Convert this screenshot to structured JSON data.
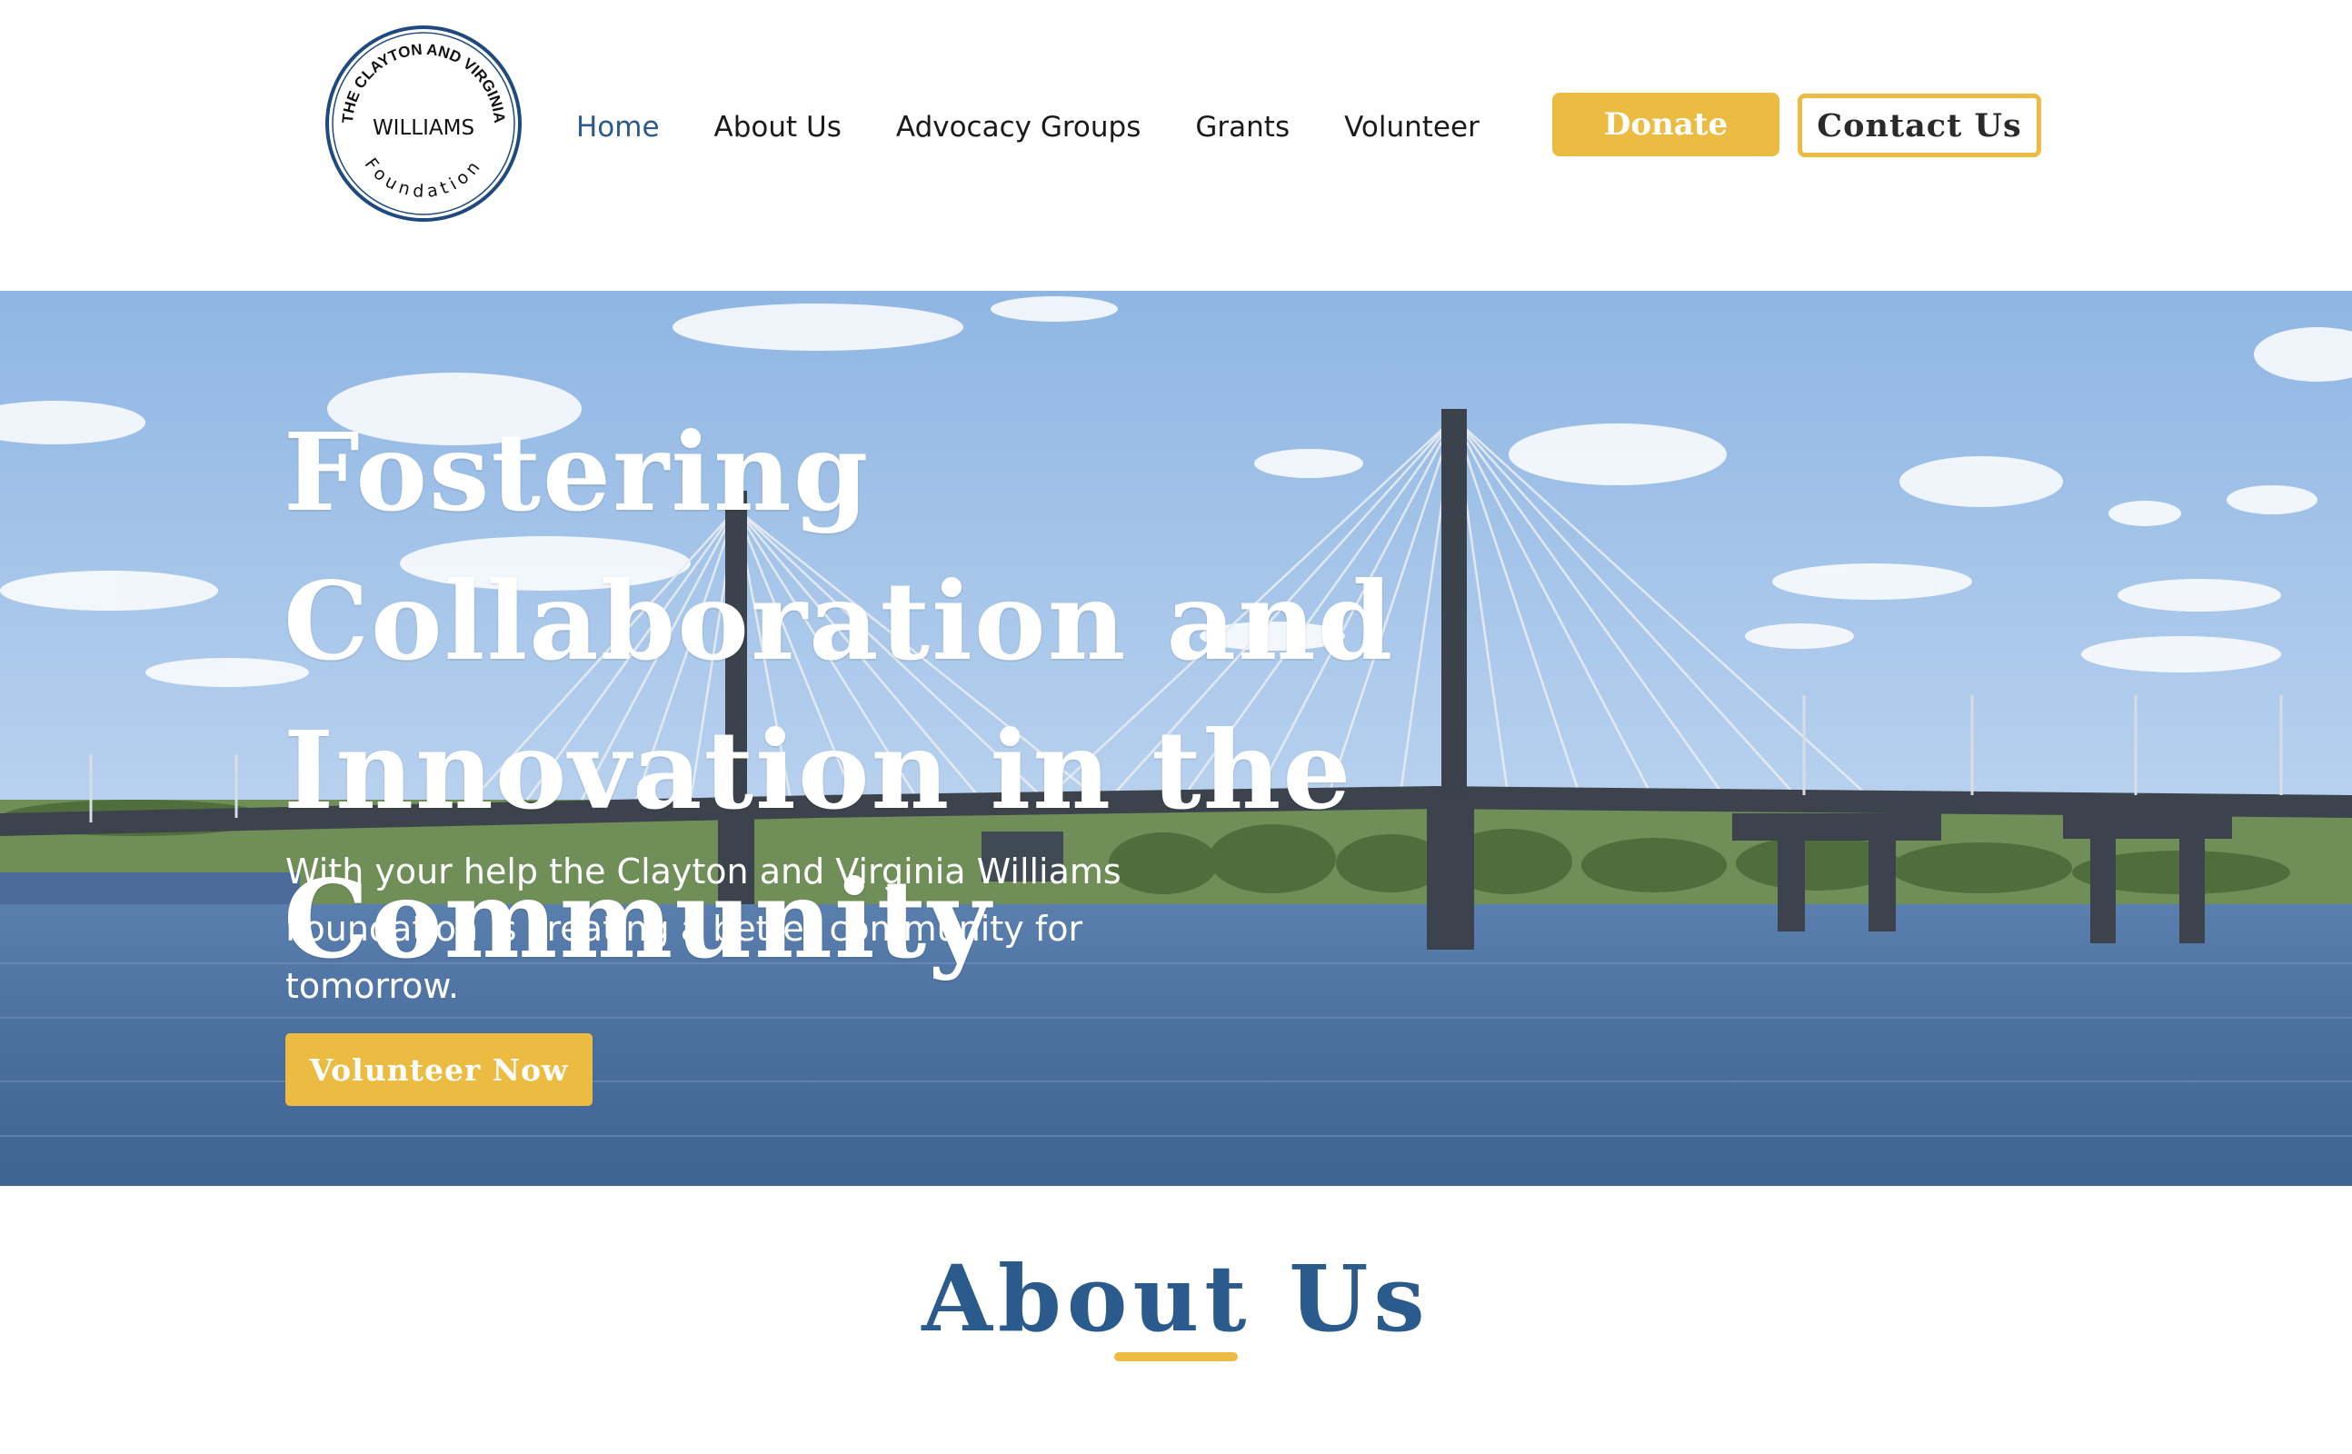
{
  "logo": {
    "top_text": "THE CLAYTON AND VIRGINIA",
    "middle_text": "WILLIAMS",
    "bottom_text": "Foundation",
    "ring_color": "#1f4a80"
  },
  "nav": {
    "items": [
      {
        "label": "Home",
        "active": true
      },
      {
        "label": "About Us"
      },
      {
        "label": "Advocacy Groups"
      },
      {
        "label": "Grants"
      },
      {
        "label": "Volunteer"
      }
    ]
  },
  "header_buttons": {
    "donate": "Donate",
    "contact": "Contact Us"
  },
  "hero": {
    "title": "Fostering Collaboration and Innovation in the Community",
    "text": "With your help the Clayton and Virginia Williams Foundation is creating a better community for tomorrow.",
    "button": "Volunteer Now"
  },
  "about": {
    "title": "About Us"
  },
  "colors": {
    "accent_gold": "#ebbb42",
    "brand_blue": "#2b5a8c",
    "nav_text": "#1a1a1a"
  }
}
